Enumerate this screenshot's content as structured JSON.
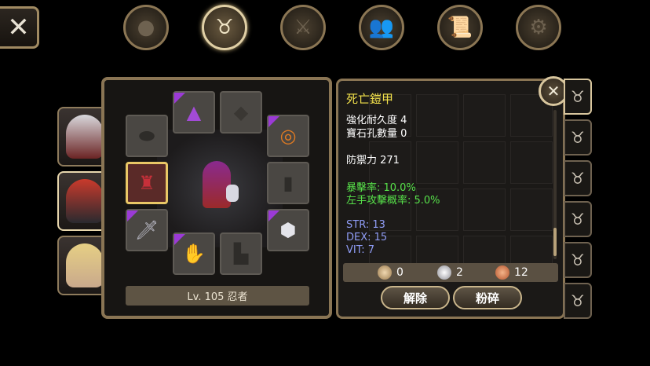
{
  "top_tabs": [
    {
      "id": "character",
      "icon": "head-silhouette-icon",
      "active": false
    },
    {
      "id": "bag",
      "icon": "bag-icon",
      "active": true
    },
    {
      "id": "skills",
      "icon": "crossed-swords-icon",
      "active": false
    },
    {
      "id": "party",
      "icon": "people-icon",
      "active": false
    },
    {
      "id": "quest",
      "icon": "scroll-icon",
      "active": false
    },
    {
      "id": "settings",
      "icon": "gear-icon",
      "active": false
    }
  ],
  "equipment": {
    "level_label": "Lv. 105 忍者"
  },
  "item": {
    "name": "死亡鎧甲",
    "enhance_durability": "強化耐久度 4",
    "socket_count": "寶石孔數量 0",
    "defense": "防禦力 271",
    "crit_rate": "暴擊率: 10.0%",
    "offhand_rate": "左手攻擊概率: 5.0%",
    "str": "STR: 13",
    "dex": "DEX: 15",
    "vit": "VIT: 7"
  },
  "currency": {
    "bronze": "0",
    "silver": "2",
    "copper": "12"
  },
  "buttons": {
    "unequip": "解除",
    "shatter": "粉碎"
  },
  "colors": {
    "accent_gold": "#e9c766",
    "title_yellow": "#f2e14b",
    "stat_green": "#57e24a",
    "stat_blue": "#8f9cf5",
    "rarity_purple": "#9b3ad6"
  }
}
